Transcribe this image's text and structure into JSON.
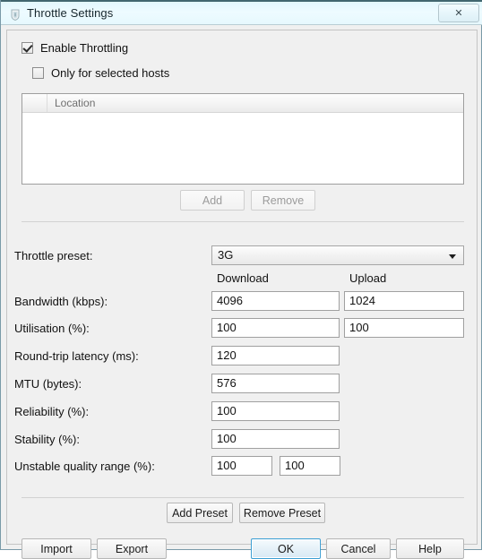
{
  "window": {
    "title": "Throttle Settings",
    "icon": "app-shield-icon",
    "close_label": "✕"
  },
  "checkboxes": {
    "enable_throttling": {
      "label": "Enable Throttling",
      "checked": true
    },
    "only_selected_hosts": {
      "label": "Only for selected hosts",
      "checked": false
    }
  },
  "host_list": {
    "columns": [
      "",
      "Location"
    ],
    "rows": []
  },
  "list_buttons": {
    "add": "Add",
    "remove": "Remove"
  },
  "preset": {
    "label": "Throttle preset:",
    "value": "3G",
    "options": [
      "3G"
    ]
  },
  "column_headers": {
    "download": "Download",
    "upload": "Upload"
  },
  "fields": [
    {
      "label": "Bandwidth (kbps):",
      "download": "4096",
      "upload": "1024"
    },
    {
      "label": "Utilisation (%):",
      "download": "100",
      "upload": "100"
    },
    {
      "label": "Round-trip latency (ms):",
      "download": "120",
      "upload": null
    },
    {
      "label": "MTU (bytes):",
      "download": "576",
      "upload": null
    },
    {
      "label": "Reliability (%):",
      "download": "100",
      "upload": null
    },
    {
      "label": "Stability (%):",
      "download": "100",
      "upload": null
    },
    {
      "label": "Unstable quality range (%):",
      "download": "100",
      "upload": "100"
    }
  ],
  "preset_buttons": {
    "add_preset": "Add Preset",
    "remove_preset": "Remove Preset"
  },
  "dialog_buttons": {
    "import": "Import",
    "export": "Export",
    "ok": "OK",
    "cancel": "Cancel",
    "help": "Help"
  },
  "colors": {
    "titlebar": "#eafbff",
    "panel_bg": "#f0f0f0",
    "default_button_border": "#3c9fd4",
    "field_border": "#a0a0a0"
  }
}
